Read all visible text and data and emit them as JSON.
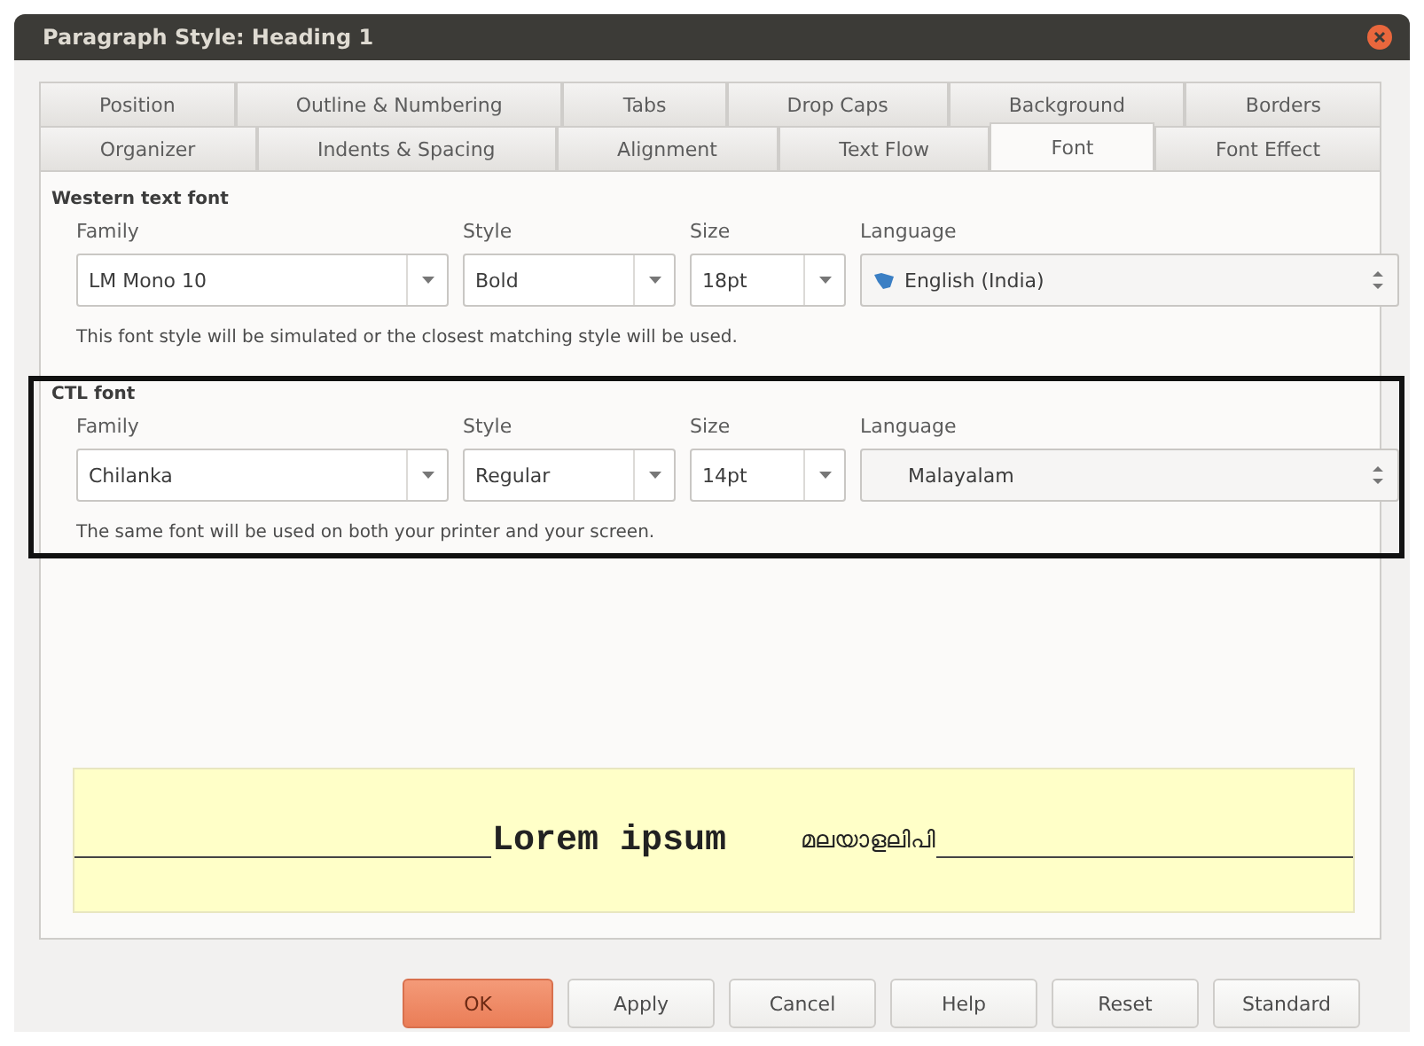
{
  "window": {
    "title": "Paragraph Style: Heading 1"
  },
  "tab_rows": [
    [
      {
        "label": "Position",
        "selected": false
      },
      {
        "label": "Outline & Numbering",
        "selected": false
      },
      {
        "label": "Tabs",
        "selected": false
      },
      {
        "label": "Drop Caps",
        "selected": false
      },
      {
        "label": "Background",
        "selected": false
      },
      {
        "label": "Borders",
        "selected": false
      }
    ],
    [
      {
        "label": "Organizer",
        "selected": false
      },
      {
        "label": "Indents & Spacing",
        "selected": false
      },
      {
        "label": "Alignment",
        "selected": false
      },
      {
        "label": "Text Flow",
        "selected": false
      },
      {
        "label": "Font",
        "selected": true
      },
      {
        "label": "Font Effect",
        "selected": false
      }
    ]
  ],
  "sections": [
    {
      "title": "Western text font",
      "highlighted": false,
      "family_label": "Family",
      "family": "LM Mono 10",
      "style_label": "Style",
      "style": "Bold",
      "size_label": "Size",
      "size": "18pt",
      "language_label": "Language",
      "language": "English (India)",
      "language_icon": true,
      "note": "This font style will be simulated or the closest matching style will be used."
    },
    {
      "title": "CTL font",
      "highlighted": true,
      "family_label": "Family",
      "family": "Chilanka",
      "style_label": "Style",
      "style": "Regular",
      "size_label": "Size",
      "size": "14pt",
      "language_label": "Language",
      "language": "Malayalam",
      "language_icon": false,
      "note": "The same font will be used on both your printer and your screen."
    }
  ],
  "preview": {
    "western_text": "Lorem ipsum",
    "ctl_text": "മലയാളലിപി"
  },
  "buttons": [
    {
      "label": "OK",
      "kind": "primary"
    },
    {
      "label": "Apply",
      "kind": "normal"
    },
    {
      "label": "Cancel",
      "kind": "normal"
    },
    {
      "label": "Help",
      "kind": "normal"
    },
    {
      "label": "Reset",
      "kind": "normal"
    },
    {
      "label": "Standard",
      "kind": "normal"
    }
  ]
}
